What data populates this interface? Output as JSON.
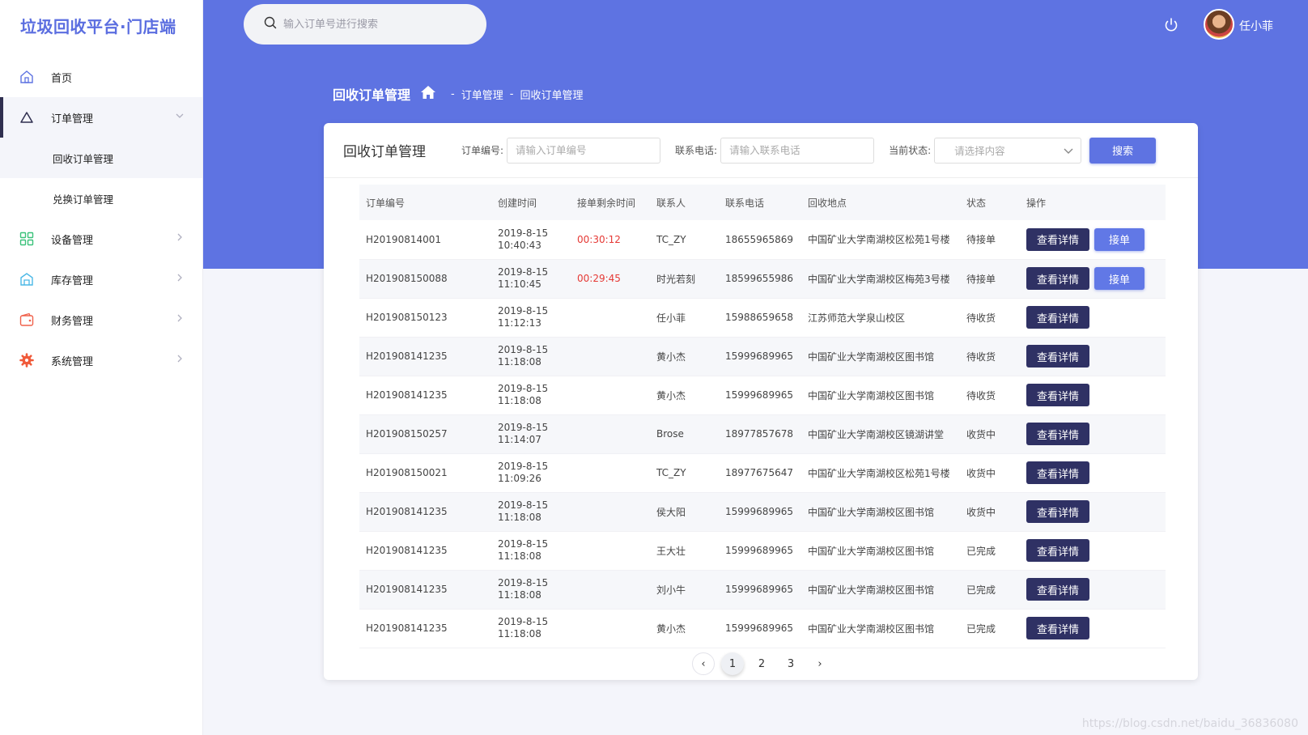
{
  "brand": "垃圾回收平台·门店端",
  "search": {
    "placeholder": "输入订单号进行搜索"
  },
  "user": {
    "name": "任小菲"
  },
  "breadcrumb": {
    "page": "回收订单管理",
    "level1": "订单管理",
    "level2": "回收订单管理",
    "sep": "-"
  },
  "sidebar": {
    "items": [
      {
        "label": "首页",
        "icon": "home-icon"
      },
      {
        "label": "订单管理",
        "icon": "triangle-icon"
      },
      {
        "label": "回收订单管理"
      },
      {
        "label": "兑换订单管理"
      },
      {
        "label": "设备管理",
        "icon": "grid-icon"
      },
      {
        "label": "库存管理",
        "icon": "warehouse-icon"
      },
      {
        "label": "财务管理",
        "icon": "wallet-icon"
      },
      {
        "label": "系统管理",
        "icon": "gear-icon"
      }
    ]
  },
  "card": {
    "title": "回收订单管理",
    "filters": {
      "order_label": "订单编号:",
      "order_placeholder": "请输入订单编号",
      "phone_label": "联系电话:",
      "phone_placeholder": "请输入联系电话",
      "status_label": "当前状态:",
      "status_placeholder": "请选择内容",
      "search_button": "搜索"
    }
  },
  "table": {
    "columns": [
      "订单编号",
      "创建时间",
      "接单剩余时间",
      "联系人",
      "联系电话",
      "回收地点",
      "状态",
      "操作"
    ],
    "detail_label": "查看详情",
    "accept_label": "接单",
    "rows": [
      {
        "id": "H20190814001",
        "date": "2019-8-15",
        "time": "10:40:43",
        "remain": "00:30:12",
        "contact": "TC_ZY",
        "phone": "18655965869",
        "address": "中国矿业大学南湖校区松苑1号楼",
        "status": "待接单",
        "accept": true
      },
      {
        "id": "H201908150088",
        "date": "2019-8-15",
        "time": "11:10:45",
        "remain": "00:29:45",
        "contact": "时光若刻",
        "phone": "18599655986",
        "address": "中国矿业大学南湖校区梅苑3号楼",
        "status": "待接单",
        "accept": true
      },
      {
        "id": "H201908150123",
        "date": "2019-8-15",
        "time": "11:12:13",
        "remain": "",
        "contact": "任小菲",
        "phone": "15988659658",
        "address": "江苏师范大学泉山校区",
        "status": "待收货",
        "accept": false
      },
      {
        "id": "H201908141235",
        "date": "2019-8-15",
        "time": "11:18:08",
        "remain": "",
        "contact": "黄小杰",
        "phone": "15999689965",
        "address": "中国矿业大学南湖校区图书馆",
        "status": "待收货",
        "accept": false
      },
      {
        "id": "H201908141235",
        "date": "2019-8-15",
        "time": "11:18:08",
        "remain": "",
        "contact": "黄小杰",
        "phone": "15999689965",
        "address": "中国矿业大学南湖校区图书馆",
        "status": "待收货",
        "accept": false
      },
      {
        "id": "H201908150257",
        "date": "2019-8-15",
        "time": "11:14:07",
        "remain": "",
        "contact": "Brose",
        "phone": "18977857678",
        "address": "中国矿业大学南湖校区镜湖讲堂",
        "status": "收货中",
        "accept": false
      },
      {
        "id": "H201908150021",
        "date": "2019-8-15",
        "time": "11:09:26",
        "remain": "",
        "contact": "TC_ZY",
        "phone": "18977675647",
        "address": "中国矿业大学南湖校区松苑1号楼",
        "status": "收货中",
        "accept": false
      },
      {
        "id": "H201908141235",
        "date": "2019-8-15",
        "time": "11:18:08",
        "remain": "",
        "contact": "侯大阳",
        "phone": "15999689965",
        "address": "中国矿业大学南湖校区图书馆",
        "status": "收货中",
        "accept": false
      },
      {
        "id": "H201908141235",
        "date": "2019-8-15",
        "time": "11:18:08",
        "remain": "",
        "contact": "王大壮",
        "phone": "15999689965",
        "address": "中国矿业大学南湖校区图书馆",
        "status": "已完成",
        "accept": false
      },
      {
        "id": "H201908141235",
        "date": "2019-8-15",
        "time": "11:18:08",
        "remain": "",
        "contact": "刘小牛",
        "phone": "15999689965",
        "address": "中国矿业大学南湖校区图书馆",
        "status": "已完成",
        "accept": false
      },
      {
        "id": "H201908141235",
        "date": "2019-8-15",
        "time": "11:18:08",
        "remain": "",
        "contact": "黄小杰",
        "phone": "15999689965",
        "address": "中国矿业大学南湖校区图书馆",
        "status": "已完成",
        "accept": false
      }
    ]
  },
  "pagination": {
    "pages": [
      "1",
      "2",
      "3"
    ],
    "current": "1",
    "prev": "‹",
    "next": "›"
  },
  "watermark": "https://blog.csdn.net/baidu_36836080",
  "colors": {
    "primary": "#5e73e2",
    "dark_button": "#2f3164",
    "countdown": "#e53935"
  }
}
